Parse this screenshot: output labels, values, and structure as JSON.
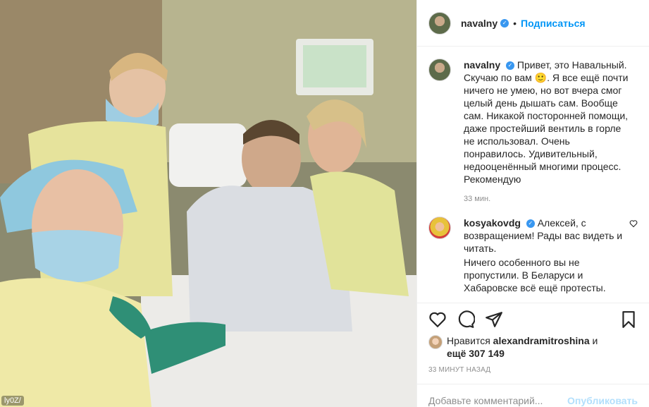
{
  "photo": {
    "watermark": "ly0Z/"
  },
  "header": {
    "username": "navalny",
    "verified": "✓",
    "separator": "•",
    "follow_label": "Подписаться"
  },
  "caption": {
    "username": "navalny",
    "text": "Привет, это Навальный. Скучаю по вам 🙂. Я все ещё почти ничего не умею, но вот вчера смог целый день дышать сам. Вообще сам. Никакой посторонней помощи, даже простейший вентиль в горле не использовал. Очень понравилось. Удивительный, недооценённый многими процесс. Рекомендую",
    "time": "33 мин."
  },
  "comment": {
    "username": "kosyakovdg",
    "text": "Алексей, с возвращением! Рады вас видеть и читать.",
    "text2": "Ничего особенного вы не пропустили. В Беларуси и Хабаровске всё ещё протесты."
  },
  "actions": {
    "like_icon": "heart-icon",
    "comment_icon": "comment-icon",
    "share_icon": "share-icon",
    "save_icon": "bookmark-icon"
  },
  "likes": {
    "prefix": "Нравится",
    "user": "alexandramitroshina",
    "and": "и",
    "more": "ещё 307 149"
  },
  "posted_time": "33 минут назад",
  "add_comment": {
    "placeholder": "Добавьте комментарий...",
    "publish_label": "Опубликовать"
  },
  "colors": {
    "accent": "#0095f6",
    "verified": "#3897f0",
    "muted": "#8e8e8e",
    "publish_disabled": "#b2dffc"
  }
}
